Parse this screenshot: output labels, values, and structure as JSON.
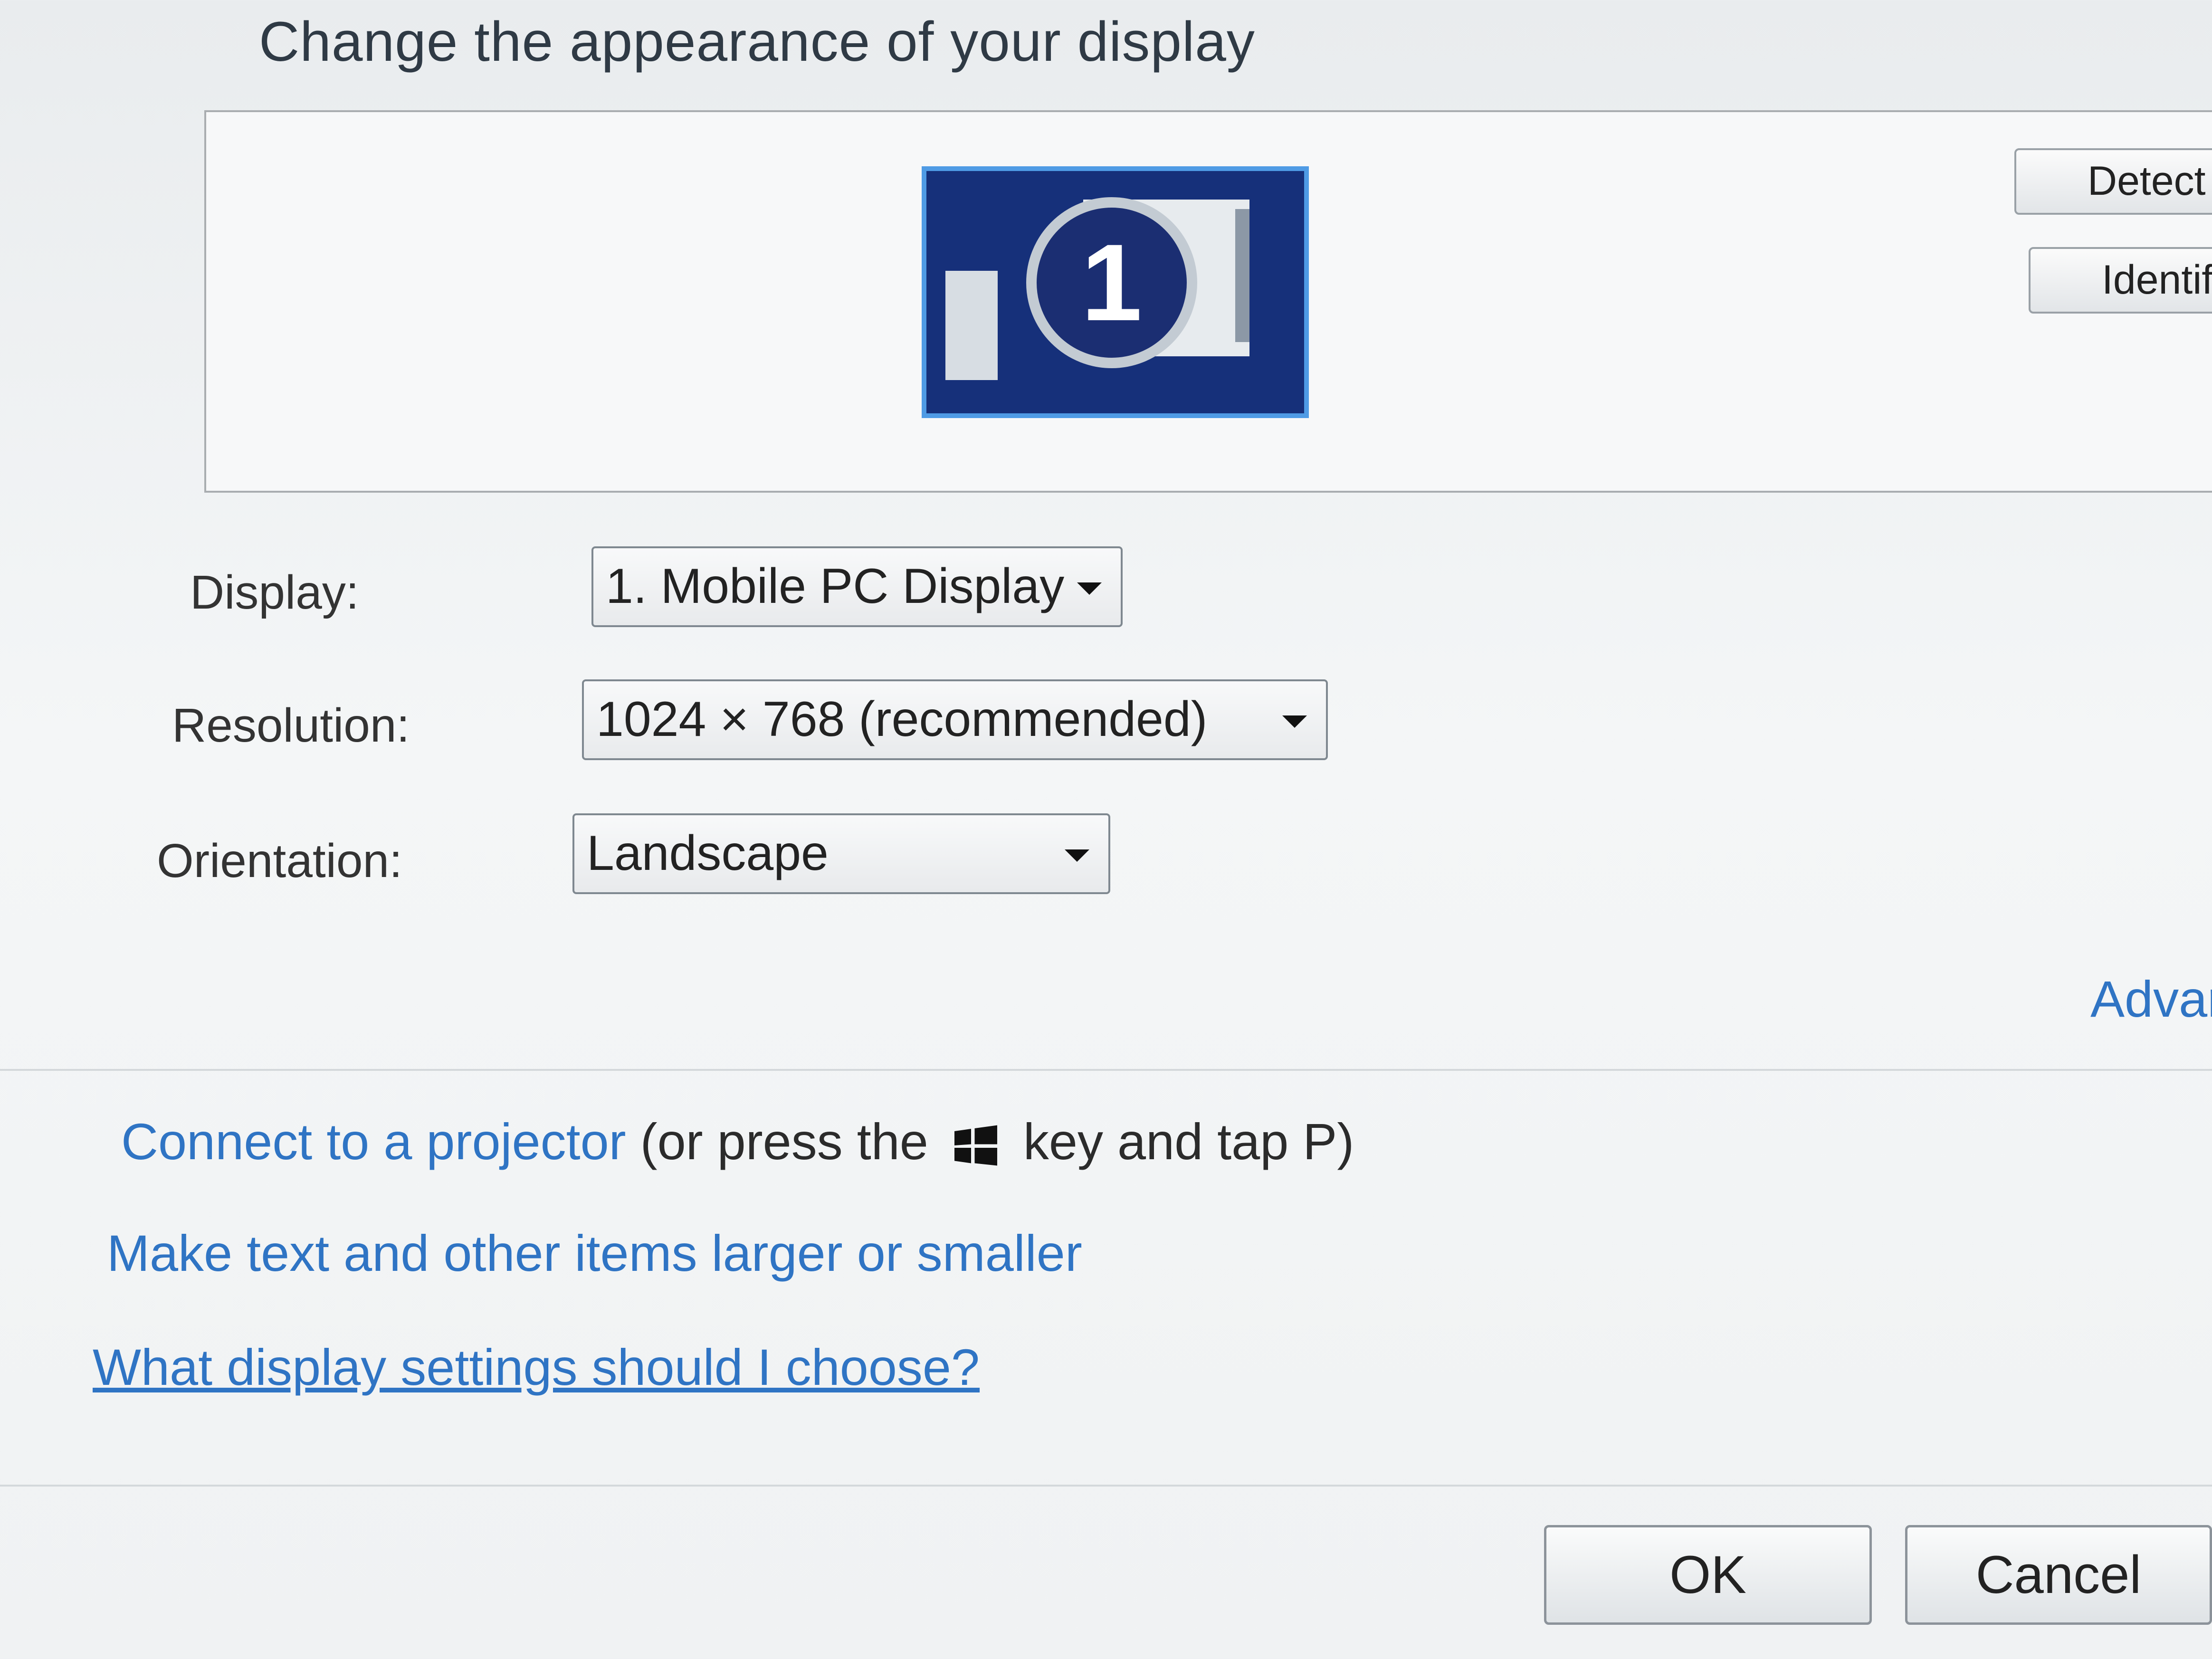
{
  "header": {
    "title": "Change the appearance of your display"
  },
  "preview": {
    "monitor_number": "1",
    "buttons": {
      "detect": "Detect",
      "identify": "Identif"
    }
  },
  "settings": {
    "display": {
      "label": "Display:",
      "value": "1. Mobile PC Display"
    },
    "resolution": {
      "label": "Resolution:",
      "value": "1024 × 768 (recommended)"
    },
    "orientation": {
      "label": "Orientation:",
      "value": "Landscape"
    },
    "advanced_link": "Advar"
  },
  "links": {
    "projector_link": "Connect to a projector",
    "projector_hint_before": "(or press the",
    "projector_hint_after": "key and tap P)",
    "text_size_link": "Make text and other items larger or smaller",
    "help_link": "What display settings should I choose?"
  },
  "footer": {
    "ok": "OK",
    "cancel": "Cancel"
  },
  "colors": {
    "link": "#2f74c4",
    "monitor_bg": "#16307a",
    "monitor_border": "#4f9be5"
  }
}
